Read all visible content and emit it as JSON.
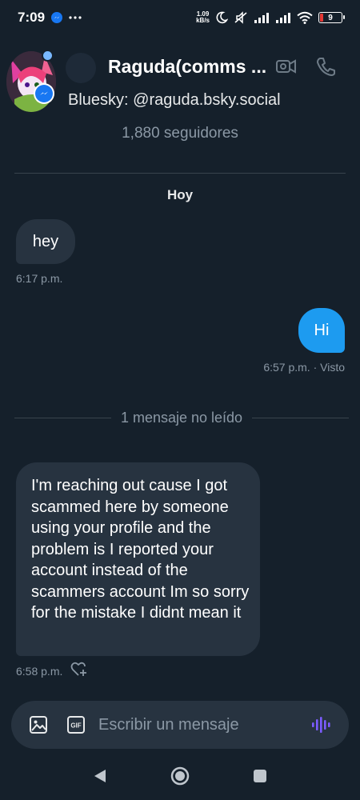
{
  "status_bar": {
    "time": "7:09",
    "net_speed_value": "1.09",
    "net_speed_unit": "kB/s",
    "battery": "9",
    "icons": [
      "messenger-icon",
      "more-dots-icon",
      "moon-icon",
      "mute-icon",
      "signal-icon",
      "signal-icon",
      "wifi-icon",
      "battery-icon"
    ]
  },
  "header": {
    "name": "Raguda(comms ...",
    "handle": "Bluesky: @raguda.bsky.social",
    "followers": "1,880 seguidores",
    "video_icon": "video-call-icon",
    "call_icon": "phone-icon"
  },
  "conversation": {
    "date_label": "Hoy",
    "messages": [
      {
        "direction": "incoming",
        "text": "hey",
        "meta": "6:17 p.m."
      },
      {
        "direction": "outgoing",
        "text": "Hi",
        "meta": "6:57 p.m. · Visto"
      },
      {
        "direction": "incoming",
        "text": "I'm reaching out cause I got scammed here by someone using your profile and the problem is I reported your account instead of the scammers account Im so sorry for the mistake I didnt mean it",
        "meta": "6:58 p.m."
      }
    ],
    "unread_divider": "1 mensaje no leído"
  },
  "composer": {
    "placeholder": "Escribir un mensaje",
    "gif_label": "GIF",
    "icons": [
      "image-icon",
      "gif-icon",
      "voice-icon"
    ]
  },
  "colors": {
    "background": "#15202b",
    "bubble_incoming": "#273340",
    "bubble_outgoing": "#1d9bf0",
    "secondary_text": "#8b98a5",
    "voice_accent": "#7c5cff"
  }
}
